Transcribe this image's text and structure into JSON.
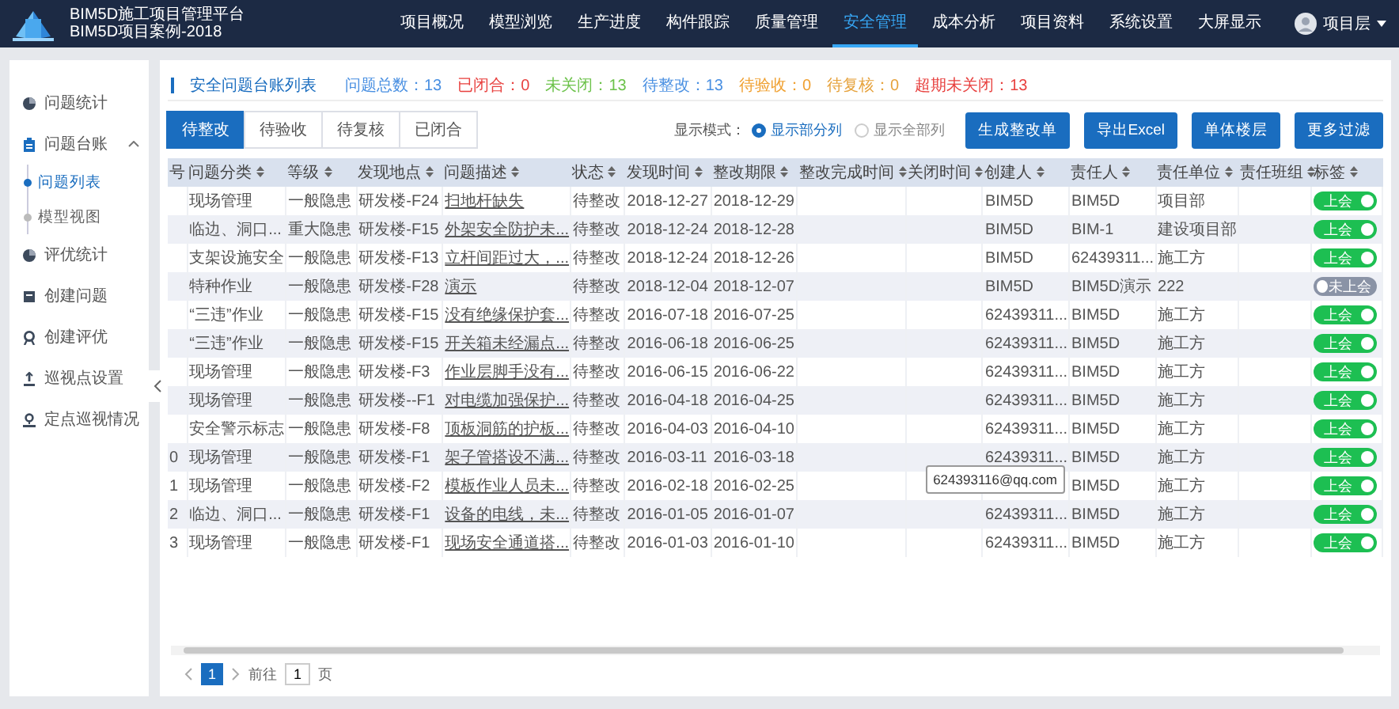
{
  "header": {
    "title_lines": [
      "BIM5D施工项目管理平台",
      "BIM5D项目案例-2018"
    ],
    "nav": [
      {
        "label": "项目概况",
        "selected": false
      },
      {
        "label": "模型浏览",
        "selected": false
      },
      {
        "label": "生产进度",
        "selected": false
      },
      {
        "label": "构件跟踪",
        "selected": false
      },
      {
        "label": "质量管理",
        "selected": false
      },
      {
        "label": "安全管理",
        "selected": true
      },
      {
        "label": "成本分析",
        "selected": false
      },
      {
        "label": "项目资料",
        "selected": false
      },
      {
        "label": "系统设置",
        "selected": false
      },
      {
        "label": "大屏显示",
        "selected": false
      }
    ],
    "user": "项目层"
  },
  "sidebar": {
    "items": [
      {
        "label": "问题统计"
      },
      {
        "label": "问题台账",
        "expanded": true,
        "children": [
          {
            "label": "问题列表",
            "selected": true
          },
          {
            "label": "模型视图",
            "selected": false
          }
        ]
      },
      {
        "label": "评优统计"
      },
      {
        "label": "创建问题"
      },
      {
        "label": "创建评优"
      },
      {
        "label": "巡视点设置"
      },
      {
        "label": "定点巡视情况"
      }
    ]
  },
  "panel": {
    "title": "安全问题台账列表",
    "stats": [
      {
        "text": "问题总数：13",
        "color": "#4a90e2"
      },
      {
        "text": "已闭合：0",
        "color": "#e8413f"
      },
      {
        "text": "未关闭：13",
        "color": "#6cc24a"
      },
      {
        "text": "待整改：13",
        "color": "#4a90e2"
      },
      {
        "text": "待验收：0",
        "color": "#f0a030"
      },
      {
        "text": "待复核：0",
        "color": "#e6a23c"
      },
      {
        "text": "超期未关闭：13",
        "color": "#e8413f"
      }
    ],
    "tabs": [
      {
        "label": "待整改",
        "selected": true
      },
      {
        "label": "待验收",
        "selected": false
      },
      {
        "label": "待复核",
        "selected": false
      },
      {
        "label": "已闭合",
        "selected": false
      }
    ],
    "display_mode": {
      "label": "显示模式：",
      "options": [
        {
          "label": "显示部分列",
          "selected": true
        },
        {
          "label": "显示全部列",
          "selected": false
        }
      ]
    },
    "buttons": [
      "生成整改单",
      "导出Excel",
      "单体楼层",
      "更多过滤"
    ],
    "table": {
      "columns": [
        "号",
        "问题分类",
        "等级",
        "发现地点",
        "问题描述",
        "状态",
        "发现时间",
        "整改期限",
        "整改完成时间",
        "关闭时间",
        "创建人",
        "责任人",
        "责任单位",
        "责任班组",
        "标签"
      ],
      "rows": [
        {
          "category": "现场管理",
          "level": "一般隐患",
          "location": "研发楼-F24",
          "description": "扫地杆缺失",
          "status": "待整改",
          "found": "2018-12-27",
          "deadline": "2018-12-29",
          "creator": "BIM5D",
          "owner": "BIM5D",
          "unit": "项目部",
          "tag": {
            "label": "上会",
            "on": true
          }
        },
        {
          "category": "临边、洞口...",
          "level": "重大隐患",
          "location": "研发楼-F15",
          "description": "外架安全防护未...",
          "status": "待整改",
          "found": "2018-12-24",
          "deadline": "2018-12-28",
          "creator": "BIM5D",
          "owner": "BIM-1",
          "unit": "建设项目部",
          "tag": {
            "label": "上会",
            "on": true
          }
        },
        {
          "category": "支架设施安全",
          "level": "一般隐患",
          "location": "研发楼-F13",
          "description": "立杆间距过大，...",
          "status": "待整改",
          "found": "2018-12-24",
          "deadline": "2018-12-26",
          "creator": "BIM5D",
          "owner": "62439311...",
          "unit": "施工方",
          "tag": {
            "label": "上会",
            "on": true
          }
        },
        {
          "category": "特种作业",
          "level": "一般隐患",
          "location": "研发楼-F28",
          "description": "演示",
          "status": "待整改",
          "found": "2018-12-04",
          "deadline": "2018-12-07",
          "creator": "BIM5D",
          "owner": "BIM5D演示",
          "unit": "222",
          "tag": {
            "label": "未上会",
            "on": false
          }
        },
        {
          "category": "“三违”作业",
          "level": "一般隐患",
          "location": "研发楼-F15",
          "description": "没有绝缘保护套...",
          "status": "待整改",
          "found": "2016-07-18",
          "deadline": "2016-07-25",
          "creator": "62439311...",
          "owner": "BIM5D",
          "unit": "施工方",
          "tag": {
            "label": "上会",
            "on": true
          }
        },
        {
          "category": "“三违”作业",
          "level": "一般隐患",
          "location": "研发楼-F15",
          "description": "开关箱未经漏点...",
          "status": "待整改",
          "found": "2016-06-18",
          "deadline": "2016-06-25",
          "creator": "62439311...",
          "owner": "BIM5D",
          "unit": "施工方",
          "tag": {
            "label": "上会",
            "on": true
          }
        },
        {
          "category": "现场管理",
          "level": "一般隐患",
          "location": "研发楼-F3",
          "description": "作业层脚手没有...",
          "status": "待整改",
          "found": "2016-06-15",
          "deadline": "2016-06-22",
          "creator": "62439311...",
          "owner": "BIM5D",
          "unit": "施工方",
          "tag": {
            "label": "上会",
            "on": true
          }
        },
        {
          "category": "现场管理",
          "level": "一般隐患",
          "location": "研发楼--F1",
          "description": "对电缆加强保护...",
          "status": "待整改",
          "found": "2016-04-18",
          "deadline": "2016-04-25",
          "creator": "62439311...",
          "owner": "BIM5D",
          "unit": "施工方",
          "tag": {
            "label": "上会",
            "on": true
          }
        },
        {
          "category": "安全警示标志",
          "level": "一般隐患",
          "location": "研发楼-F8",
          "description": "顶板洞筋的护板...",
          "status": "待整改",
          "found": "2016-04-03",
          "deadline": "2016-04-10",
          "creator": "62439311...",
          "owner": "BIM5D",
          "unit": "施工方",
          "tag": {
            "label": "上会",
            "on": true
          }
        },
        {
          "index": "0",
          "category": "现场管理",
          "level": "一般隐患",
          "location": "研发楼-F1",
          "description": "架子管搭设不满...",
          "status": "待整改",
          "found": "2016-03-11",
          "deadline": "2016-03-18",
          "creator": "62439311...",
          "owner": "BIM5D",
          "unit": "施工方",
          "tag": {
            "label": "上会",
            "on": true
          }
        },
        {
          "index": "1",
          "category": "现场管理",
          "level": "一般隐患",
          "location": "研发楼-F2",
          "description": "模板作业人员未...",
          "status": "待整改",
          "found": "2016-02-18",
          "deadline": "2016-02-25",
          "tooltip": "624393116@qq.com",
          "owner": "BIM5D",
          "unit": "施工方",
          "tag": {
            "label": "上会",
            "on": true
          }
        },
        {
          "index": "2",
          "category": "临边、洞口...",
          "level": "一般隐患",
          "location": "研发楼-F1",
          "description": "设备的电线，未...",
          "status": "待整改",
          "found": "2016-01-05",
          "deadline": "2016-01-07",
          "creator": "62439311...",
          "owner": "BIM5D",
          "unit": "施工方",
          "tag": {
            "label": "上会",
            "on": true
          }
        },
        {
          "index": "3",
          "category": "现场管理",
          "level": "一般隐患",
          "location": "研发楼-F1",
          "description": "现场安全通道搭...",
          "status": "待整改",
          "found": "2016-01-03",
          "deadline": "2016-01-10",
          "creator": "62439311...",
          "owner": "BIM5D",
          "unit": "施工方",
          "tag": {
            "label": "上会",
            "on": true
          }
        }
      ]
    },
    "pagination": {
      "pages": [
        {
          "label": "1",
          "selected": true
        }
      ],
      "goto_label": "前往",
      "goto_value": "1",
      "unit": "页"
    }
  }
}
